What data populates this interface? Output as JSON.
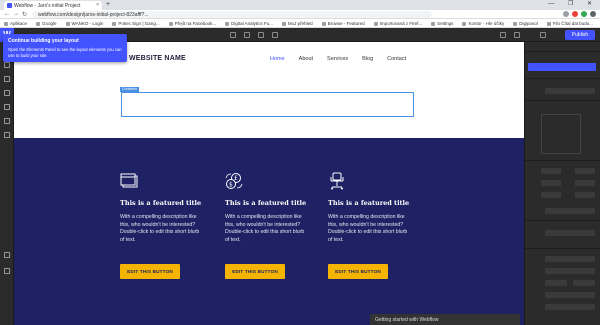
{
  "browser": {
    "tab_title": "Webflow - Jaro's initial Project",
    "tab_close": "×",
    "new_tab": "+",
    "window_controls": "— ❐ ✕",
    "nav_back": "←",
    "nav_forward": "→",
    "nav_reload": "↻",
    "url": "webflow.com/design/jaros-initial-project-823afff?...",
    "bookmarks": [
      "Aplikace",
      "Google",
      "WANKO - Login",
      "Pokec Sign | Gang...",
      "Přejít na Facebook...",
      "Digital Analytics Fu...",
      "MoJ přehled",
      "Browse - Featured",
      "Importovaná z Firef...",
      "Settings",
      "Kontor - Hle účtky",
      "Digiposol",
      "Filo Čítal dat budo...",
      "Jak na reklamu na..."
    ]
  },
  "designer": {
    "logo": "W",
    "publish_label": "Publish"
  },
  "tooltip": {
    "title": "Continue building your layout",
    "body": "Open the Elements Panel to see the layout elements you can use to build your site."
  },
  "site": {
    "brand": "WEBSITE NAME",
    "nav": [
      "Home",
      "About",
      "Services",
      "Blog",
      "Contact"
    ],
    "container_tag": "Container",
    "features": [
      {
        "icon": "browser-window-icon",
        "title": "This is a featured title",
        "description": "With a compelling description like this, who wouldn't be interested? Double-click to edit this short blurb of text.",
        "button": "EDIT THIS BUTTON"
      },
      {
        "icon": "currency-exchange-icon",
        "title": "This is a featured title",
        "description": "With a compelling description like this, who wouldn't be interested? Double-click to edit this short blurb of text.",
        "button": "EDIT THIS BUTTON"
      },
      {
        "icon": "office-chair-icon",
        "title": "This is a featured title",
        "description": "With a compelling description like this, who wouldn't be interested? Double-click to edit this short blurb of text.",
        "button": "EDIT THIS BUTTON"
      }
    ]
  },
  "getting_started": "Getting started with Webflow",
  "colors": {
    "accent": "#4353ff",
    "features_bg": "#1e2264",
    "button": "#f5b400"
  }
}
